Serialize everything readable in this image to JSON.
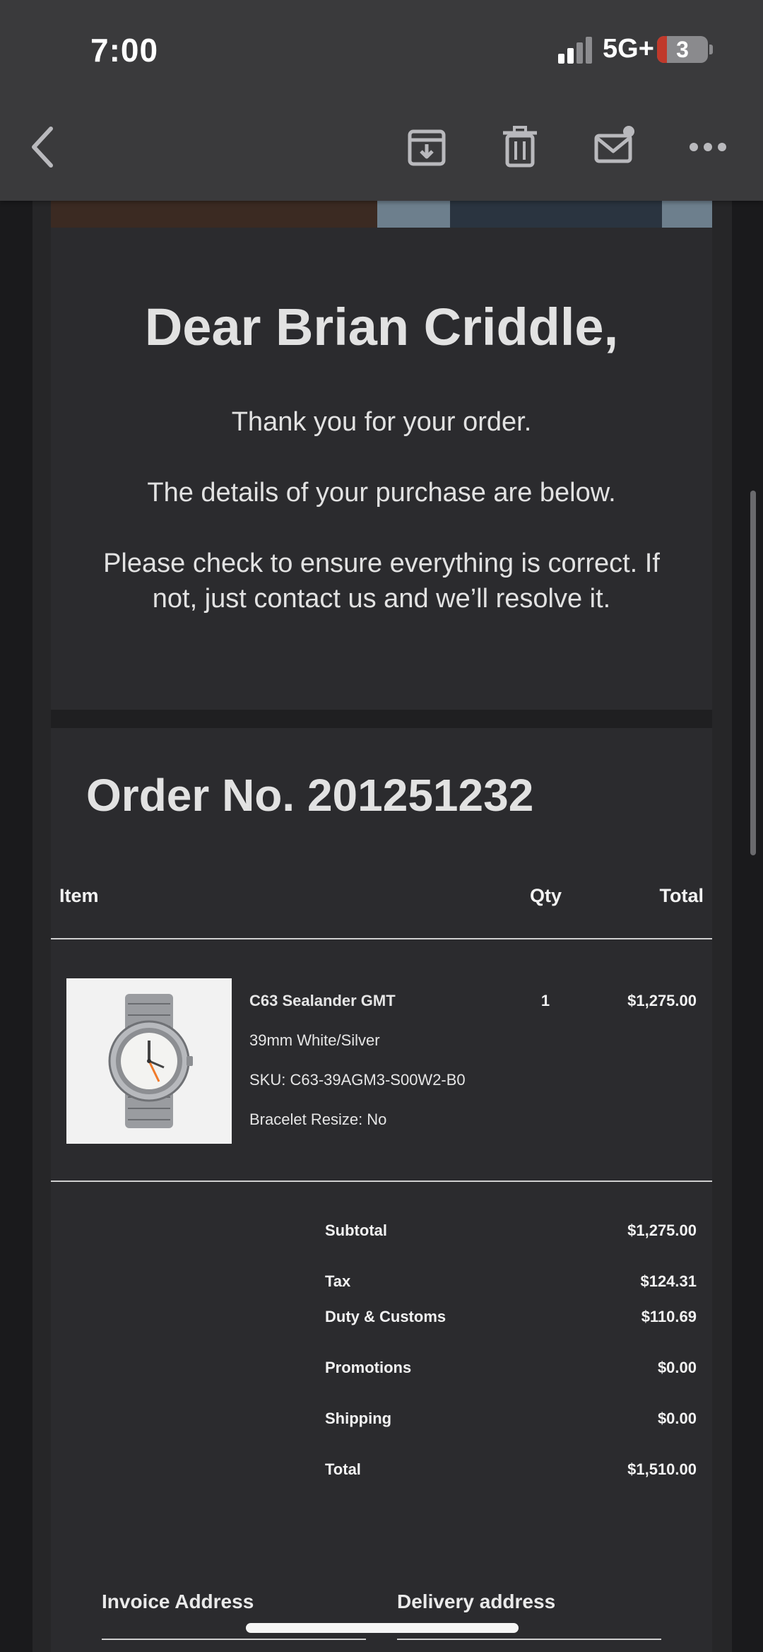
{
  "status_bar": {
    "time": "7:00",
    "network": "5G+",
    "battery": "3"
  },
  "toolbar": {
    "back_icon": "chevron-left-icon",
    "archive_icon": "archive-icon",
    "delete_icon": "trash-icon",
    "mark_unread_icon": "mail-unread-icon",
    "more_icon": "more-horizontal-icon"
  },
  "email": {
    "greeting": "Dear Brian Criddle,",
    "thanks": "Thank you for your order.",
    "details": "The details of your purchase are below.",
    "check": "Please check to ensure everything is correct. If not, just contact us and we’ll resolve it.",
    "order_title": "Order No. 201251232",
    "table_headers": {
      "item": "Item",
      "qty": "Qty",
      "total": "Total"
    },
    "item": {
      "name": "C63 Sealander GMT",
      "variant": "39mm White/Silver",
      "sku": "SKU: C63-39AGM3-S00W2-B0",
      "resize": "Bracelet Resize: No",
      "qty": "1",
      "total": "$1,275.00"
    },
    "summary": [
      {
        "label": "Subtotal",
        "value": "$1,275.00"
      },
      {
        "label": "Tax",
        "value": "$124.31"
      },
      {
        "label": "Duty & Customs",
        "value": "$110.69"
      },
      {
        "label": "Promotions",
        "value": "$0.00"
      },
      {
        "label": "Shipping",
        "value": "$0.00"
      },
      {
        "label": "Total",
        "value": "$1,510.00"
      }
    ],
    "invoice_address": "Invoice Address",
    "delivery_address": "Delivery address"
  },
  "colors": {
    "background": "#262628",
    "card": "#2b2b2e",
    "toolbar": "#3a3a3c",
    "text": "#e2e2e2",
    "accent_watch_hand": "#f07a2a"
  }
}
